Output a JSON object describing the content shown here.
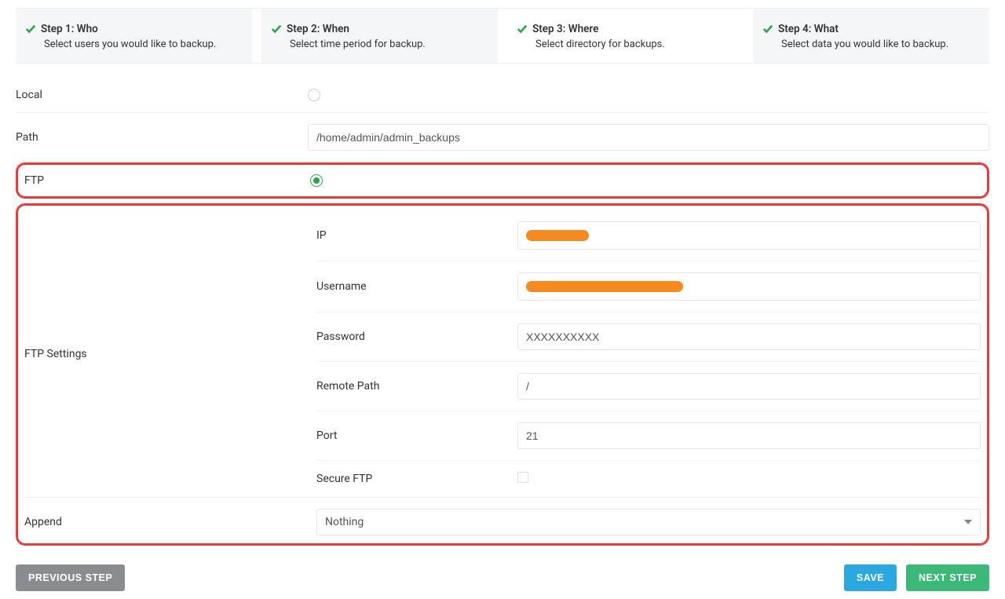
{
  "steps": [
    {
      "title": "Step 1: Who",
      "sub": "Select users you would like to backup.",
      "grey": true
    },
    {
      "title": "Step 2: When",
      "sub": "Select time period for backup.",
      "grey": true
    },
    {
      "title": "Step 3: Where",
      "sub": "Select directory for backups.",
      "grey": false
    },
    {
      "title": "Step 4: What",
      "sub": "Select data you would like to backup.",
      "grey": true
    }
  ],
  "labels": {
    "local": "Local",
    "path": "Path",
    "ftp": "FTP",
    "ftpSettings": "FTP Settings",
    "ip": "IP",
    "username": "Username",
    "password": "Password",
    "remotePath": "Remote Path",
    "port": "Port",
    "secureFtp": "Secure FTP",
    "append": "Append"
  },
  "values": {
    "path": "/home/admin/admin_backups",
    "password": "XXXXXXXXXX",
    "remotePath": "/",
    "port": "21",
    "append": "Nothing"
  },
  "buttons": {
    "prev": "PREVIOUS STEP",
    "save": "SAVE",
    "next": "NEXT STEP"
  },
  "redact": {
    "ipWidth": 80,
    "usernameWidth": 200
  }
}
